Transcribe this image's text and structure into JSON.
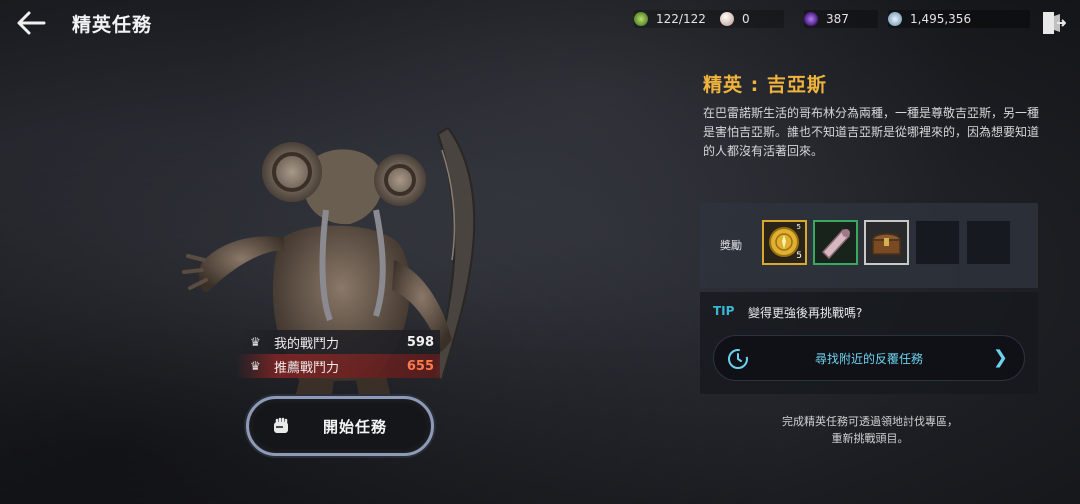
{
  "header": {
    "title": "精英任務"
  },
  "resources": [
    {
      "name": "stamina",
      "icon": "stamina-icon",
      "color": "#7fc04a",
      "value": "122/122"
    },
    {
      "name": "pearl",
      "icon": "pearl-icon",
      "color": "#e8d8d0",
      "value": "0"
    },
    {
      "name": "black-gem",
      "icon": "dark-gem-icon",
      "color": "#6a3aa8",
      "value": "387"
    },
    {
      "name": "silver",
      "icon": "silver-coin-icon",
      "color": "#b8cfe0",
      "value": "1,495,356"
    }
  ],
  "combat": {
    "my_label": "我的戰鬥力",
    "my_value": "598",
    "rec_label": "推薦戰鬥力",
    "rec_value": "655"
  },
  "start_button": {
    "label": "開始任務"
  },
  "quest": {
    "title": "精英 : 吉亞斯",
    "description": "在巴雷諾斯生活的哥布林分為兩種，一種是尊敬吉亞斯，另一種是害怕吉亞斯。誰也不知道吉亞斯是從哪裡來的，因為想要知道的人都沒有活著回來。"
  },
  "rewards": {
    "label": "獎勵",
    "items": [
      {
        "icon": "gold-coin-icon",
        "count": "5",
        "badge": "5",
        "border": "#d8a830"
      },
      {
        "icon": "scroll-icon",
        "count": "",
        "badge": "",
        "border": "#3aa860"
      },
      {
        "icon": "treasure-chest-icon",
        "count": "",
        "badge": "",
        "border": "#c8c8c8"
      },
      {
        "icon": "",
        "count": "",
        "badge": "",
        "border": ""
      },
      {
        "icon": "",
        "count": "",
        "badge": "",
        "border": ""
      }
    ]
  },
  "tip": {
    "tag": "TIP",
    "text": "變得更強後再挑戰嗎?",
    "button_label": "尋找附近的反覆任務"
  },
  "footnote": {
    "line1": "完成精英任務可透過領地討伐專區，",
    "line2": "重新挑戰頭目。"
  }
}
